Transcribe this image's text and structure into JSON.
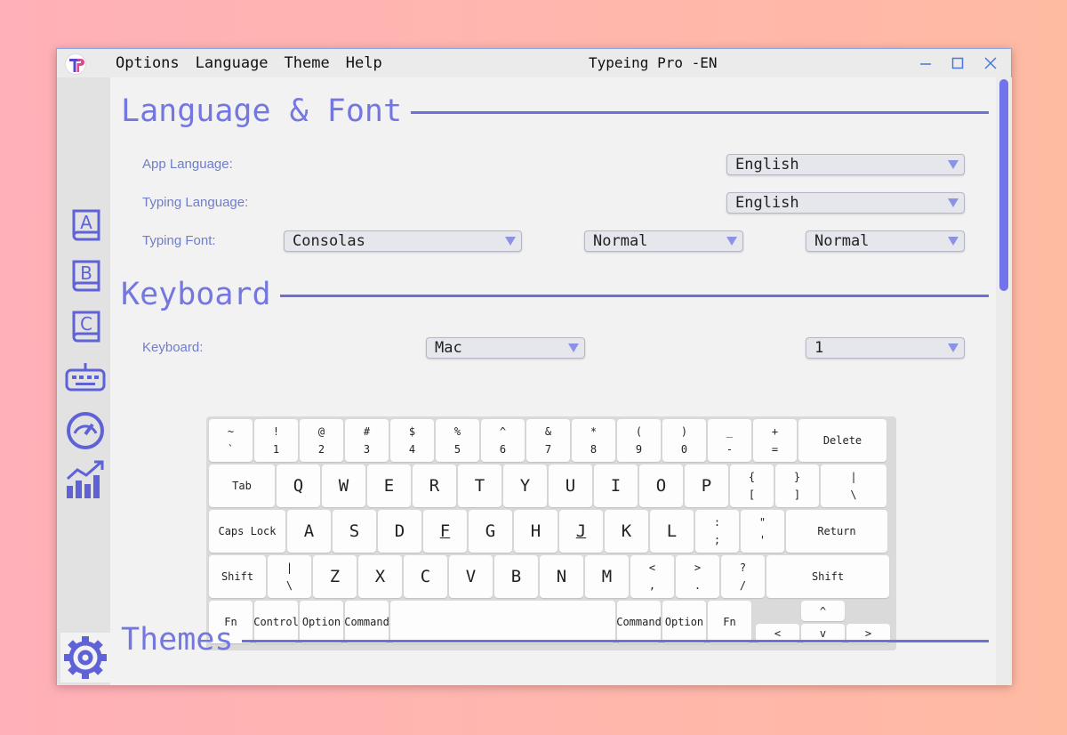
{
  "window": {
    "title": "Typeing Pro -EN",
    "menu": [
      "Options",
      "Language",
      "Theme",
      "Help"
    ]
  },
  "colors": {
    "accent": "#7477e0",
    "rule": "#6d70d8",
    "scroll": "#7273ea",
    "label": "#707dc8"
  },
  "sidebar": [
    "book-a-icon",
    "book-b-icon",
    "book-c-icon",
    "keyboard-icon",
    "speedometer-icon",
    "chart-icon",
    "gear-icon"
  ],
  "language_font": {
    "heading": "Language & Font",
    "app_language_label": "App Language:",
    "app_language_value": "English",
    "typing_language_label": "Typing Language:",
    "typing_language_value": "English",
    "typing_font_label": "Typing Font:",
    "font_family": "Consolas",
    "font_weight": "Normal",
    "font_style": "Normal"
  },
  "keyboard": {
    "heading": "Keyboard",
    "label": "Keyboard:",
    "layout": "Mac",
    "variant": "1",
    "rows": [
      [
        {
          "t": "~",
          "b": "`"
        },
        {
          "t": "!",
          "b": "1"
        },
        {
          "t": "@",
          "b": "2"
        },
        {
          "t": "#",
          "b": "3"
        },
        {
          "t": "$",
          "b": "4"
        },
        {
          "t": "%",
          "b": "5"
        },
        {
          "t": "^",
          "b": "6"
        },
        {
          "t": "&",
          "b": "7"
        },
        {
          "t": "*",
          "b": "8"
        },
        {
          "t": "(",
          "b": "9"
        },
        {
          "t": ")",
          "b": "0"
        },
        {
          "t": "_",
          "b": "-"
        },
        {
          "t": "+",
          "b": "="
        },
        {
          "m": "Delete"
        }
      ],
      [
        {
          "m": "Tab"
        },
        {
          "l": "Q"
        },
        {
          "l": "W"
        },
        {
          "l": "E"
        },
        {
          "l": "R"
        },
        {
          "l": "T"
        },
        {
          "l": "Y"
        },
        {
          "l": "U"
        },
        {
          "l": "I"
        },
        {
          "l": "O"
        },
        {
          "l": "P"
        },
        {
          "t": "{",
          "b": "["
        },
        {
          "t": "}",
          "b": "]"
        },
        {
          "t": "|",
          "b": "\\"
        }
      ],
      [
        {
          "m": "Caps Lock"
        },
        {
          "l": "A"
        },
        {
          "l": "S"
        },
        {
          "l": "D"
        },
        {
          "l": "F"
        },
        {
          "l": "G"
        },
        {
          "l": "H"
        },
        {
          "l": "J"
        },
        {
          "l": "K"
        },
        {
          "l": "L"
        },
        {
          "t": ":",
          "b": ";"
        },
        {
          "t": "\"",
          "b": "'"
        },
        {
          "m": "Return"
        }
      ],
      [
        {
          "m": "Shift"
        },
        {
          "t": "|",
          "b": "\\"
        },
        {
          "l": "Z"
        },
        {
          "l": "X"
        },
        {
          "l": "C"
        },
        {
          "l": "V"
        },
        {
          "l": "B"
        },
        {
          "l": "N"
        },
        {
          "l": "M"
        },
        {
          "t": "<",
          "b": ","
        },
        {
          "t": ">",
          "b": "."
        },
        {
          "t": "?",
          "b": "/"
        },
        {
          "m": "Shift"
        }
      ],
      [
        {
          "m": "Fn"
        },
        {
          "m": "Control"
        },
        {
          "m": "Option"
        },
        {
          "m": "Command"
        },
        {
          "m": ""
        },
        {
          "m": "Command"
        },
        {
          "m": "Option"
        },
        {
          "m": "Fn"
        },
        {
          "m": "^"
        },
        {
          "m": "<"
        },
        {
          "m": "v"
        },
        {
          "m": ">"
        }
      ]
    ]
  },
  "themes": {
    "heading": "Themes"
  }
}
